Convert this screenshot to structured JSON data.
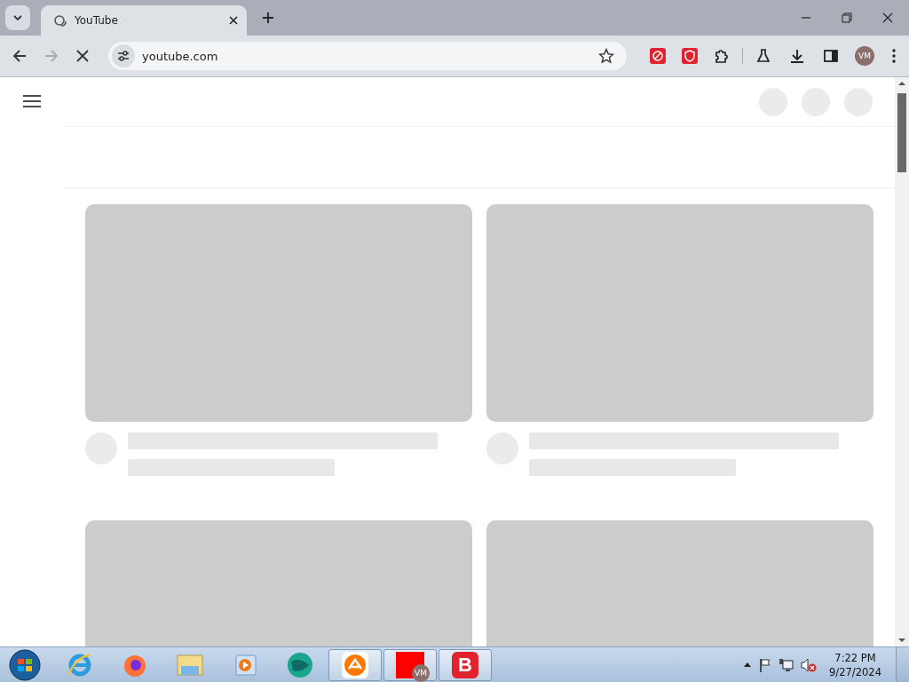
{
  "browser": {
    "tabs": [
      {
        "label": "YouTube",
        "selected": true
      }
    ],
    "toolbar": {
      "forward_disabled": true,
      "loading": true,
      "address": "youtube.com",
      "bookmarked": false,
      "profile_initials": "VM"
    },
    "extensions": [
      {
        "kind": "red-target"
      },
      {
        "kind": "red-shield"
      },
      {
        "kind": "puzzle"
      }
    ]
  },
  "page": {
    "header_placeholders": [
      {
        "kind": "circle"
      },
      {
        "kind": "circle"
      },
      {
        "kind": "circle"
      }
    ],
    "cards": [
      {
        "kind": "skeleton"
      },
      {
        "kind": "skeleton"
      },
      {
        "kind": "thumbnail"
      },
      {
        "kind": "thumbnail"
      }
    ]
  },
  "taskbar": {
    "apps": [
      {
        "kind": "ie",
        "running": false
      },
      {
        "kind": "firefox",
        "running": false
      },
      {
        "kind": "explorer",
        "running": false
      },
      {
        "kind": "media",
        "running": false
      },
      {
        "kind": "globe",
        "running": false
      },
      {
        "kind": "avast",
        "running": true
      },
      {
        "kind": "vm",
        "running": true,
        "badge": "VM"
      },
      {
        "kind": "bitdefender",
        "running": true,
        "letter": "B"
      }
    ],
    "clock": {
      "time": "7:22 PM",
      "date": "9/27/2024"
    }
  }
}
